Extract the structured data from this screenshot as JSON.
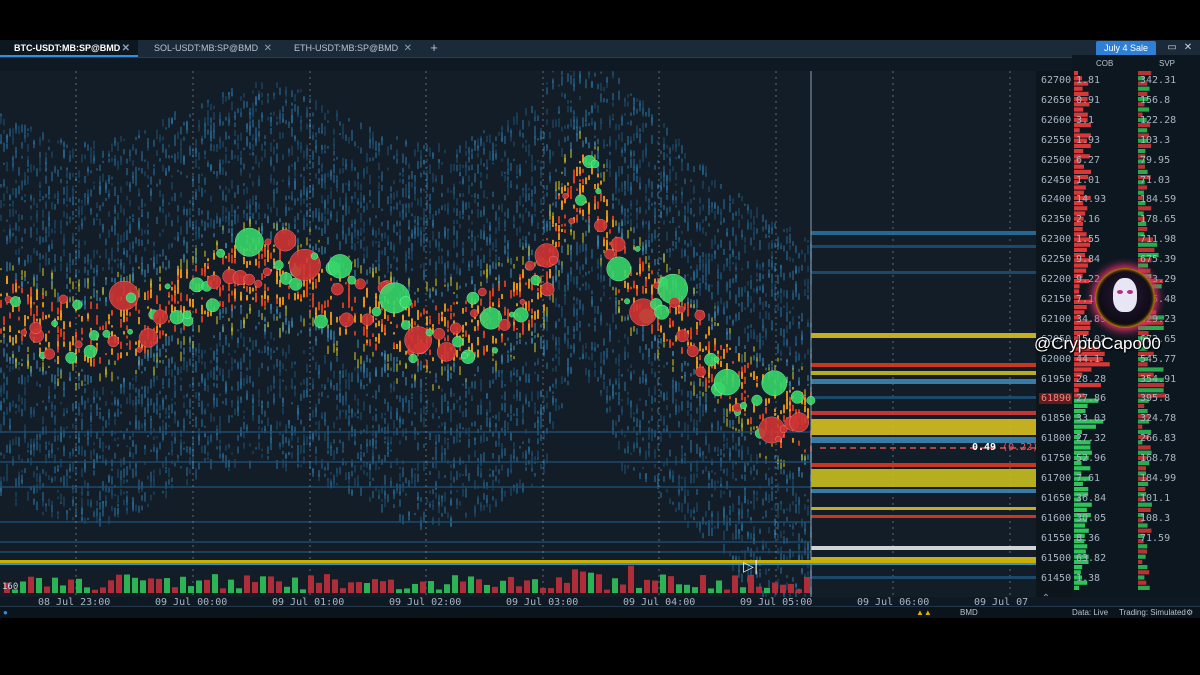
{
  "tabs": [
    {
      "label": "BTC-USDT:MB:SP@BMD",
      "active": true
    },
    {
      "label": "SOL-USDT:MB:SP@BMD",
      "active": false
    },
    {
      "label": "ETH-USDT:MB:SP@BMD",
      "active": false
    }
  ],
  "tab_close_glyph": "✕",
  "add_tab_glyph": "+",
  "promo_button": "July 4 Sale",
  "columns": {
    "cob": "COB",
    "svp": "SVP"
  },
  "price_axis": [
    "62700",
    "62650",
    "62600",
    "62550",
    "62500",
    "62450",
    "62400",
    "62350",
    "62300",
    "62250",
    "62200",
    "62150",
    "62100",
    "62050",
    "62000",
    "61950",
    "61890",
    "61850",
    "61800",
    "61750",
    "61700",
    "61650",
    "61600",
    "61550",
    "61500",
    "61450"
  ],
  "current_price": "61890",
  "cob_values": [
    "1.81",
    "0.91",
    "3.1",
    "1.93",
    "6.27",
    "1.01",
    "14.93",
    "2.16",
    "1.55",
    "9.84",
    "9.22",
    "7.16",
    "34.89",
    "15.02",
    "44.1",
    "28.28",
    "27.86",
    "33.03",
    "27.32",
    "52.96",
    "7.61",
    "36.84",
    "30.05",
    "8.36",
    "63.82",
    "1.38"
  ],
  "svp_values": [
    "342.31",
    "156.8",
    "122.28",
    "103.3",
    "79.95",
    "71.03",
    "184.59",
    "178.65",
    "711.98",
    "675.39",
    "623.29",
    "765.48",
    "829.23",
    "672.65",
    "545.77",
    "354.91",
    "395.8",
    "324.78",
    "266.83",
    "168.78",
    "184.99",
    "101.1",
    "108.3",
    "71.59"
  ],
  "level_marker": {
    "size": "0.49",
    "delta": "(0.22)"
  },
  "left_axis_value": "160",
  "time_axis": [
    "08 Jul 23:00",
    "09 Jul 00:00",
    "09 Jul 01:00",
    "09 Jul 02:00",
    "09 Jul 03:00",
    "09 Jul 04:00",
    "09 Jul 05:00",
    "09 Jul 06:00",
    "09 Jul 07"
  ],
  "status": {
    "exchange": "BMD",
    "data": "Data: Live",
    "trading": "Trading: Simulated"
  },
  "watermark": "@CryptoCapo00",
  "icons": [
    "window-icon",
    "close-window-icon",
    "play-icon",
    "settings-icon"
  ],
  "colors": {
    "accent": "#2f7fd6",
    "buy": "#33e070",
    "sell": "#e03a3a",
    "heat_hot": "#ffd400",
    "heat_mid": "#d8461e",
    "heat_cool": "#2a6f9c"
  }
}
